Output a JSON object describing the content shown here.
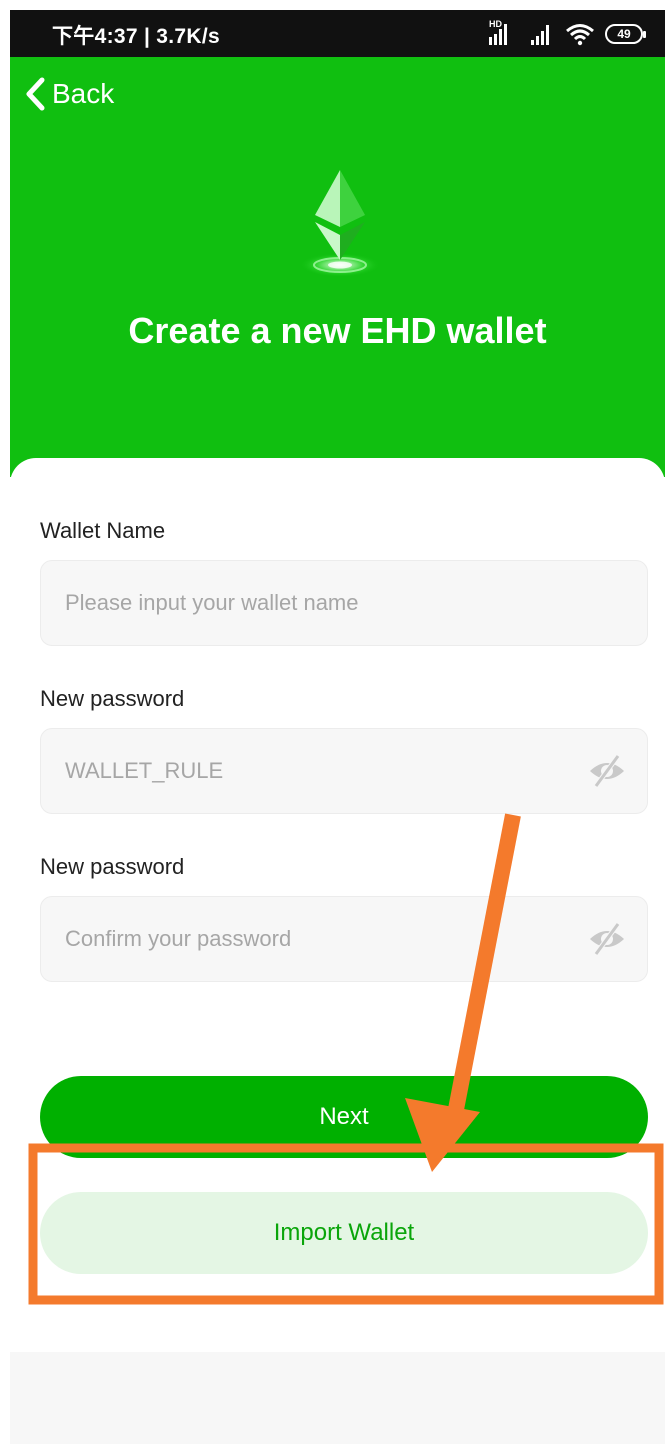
{
  "status_bar": {
    "time_speed": "下午4:37 | 3.7K/s",
    "hd_label": "HD",
    "battery": "49"
  },
  "header": {
    "back_label": "Back",
    "title": "Create a new EHD wallet"
  },
  "form": {
    "wallet_name_label": "Wallet Name",
    "wallet_name_placeholder": "Please input your wallet name",
    "new_password_label": "New password",
    "new_password_placeholder": "WALLET_RULE",
    "confirm_password_label": "New password",
    "confirm_password_placeholder": "Confirm your password"
  },
  "actions": {
    "next_label": "Next",
    "import_label": "Import Wallet"
  },
  "colors": {
    "header_green": "#10bf10",
    "primary_button": "#00b000",
    "secondary_button_bg": "#e4f6e4",
    "secondary_button_text": "#0aa50a",
    "annotation_orange": "#f47a2c"
  },
  "icons": [
    "chevron-left-icon",
    "ethereum-logo-icon",
    "eye-off-icon",
    "signal-icon",
    "wifi-icon",
    "battery-icon"
  ]
}
